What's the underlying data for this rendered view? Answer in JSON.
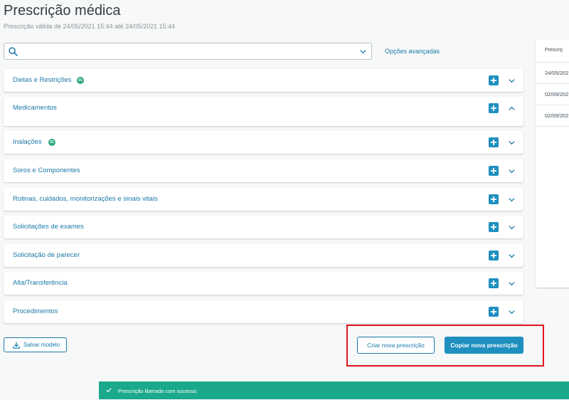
{
  "header": {
    "title": "Prescrição médica",
    "subtitle": "Prescrição válida de 24/05/2021 15:44 até 24/05/2021 15:44"
  },
  "search": {
    "value": "",
    "placeholder": "",
    "advanced_link": "Opções avançadas"
  },
  "sections": [
    {
      "label": "Dietas e Restrições",
      "badge": "01",
      "expanded": false
    },
    {
      "label": "Medicamentos",
      "badge": "",
      "expanded": true
    },
    {
      "label": "Inalações",
      "badge": "01",
      "expanded": false
    },
    {
      "label": "Soros e Componentes",
      "badge": "",
      "expanded": false
    },
    {
      "label": "Rotinas, cuidados, monitorizações e sinais vitais",
      "badge": "",
      "expanded": false
    },
    {
      "label": "Solicitações de exames",
      "badge": "",
      "expanded": false
    },
    {
      "label": "Solicitação de parecer",
      "badge": "",
      "expanded": false
    },
    {
      "label": "Alta/Transferência",
      "badge": "",
      "expanded": false
    },
    {
      "label": "Procedimentos",
      "badge": "",
      "expanded": false
    }
  ],
  "history_panel": {
    "header": "Prescriç",
    "rows": [
      "24/05/202",
      "02/09/202",
      "02/09/202"
    ]
  },
  "actions": {
    "save_template": "Salvar modelo",
    "create_new": "Criar nova prescrição",
    "copy_new": "Copiar nova prescrição"
  },
  "toast": {
    "message": "Prescrição liberada com sucesso."
  },
  "colors": {
    "accent": "#1e8fbf",
    "link": "#1a79a8",
    "badge": "#2fa87a",
    "toast": "#1aa98a",
    "highlight": "#e0141e"
  },
  "icons": {
    "search": "search-icon",
    "dropdown": "chevron-down-icon",
    "add": "plus-icon",
    "collapse": "chevron-up-icon",
    "expand": "chevron-down-icon",
    "download": "download-icon",
    "success": "check-icon"
  }
}
